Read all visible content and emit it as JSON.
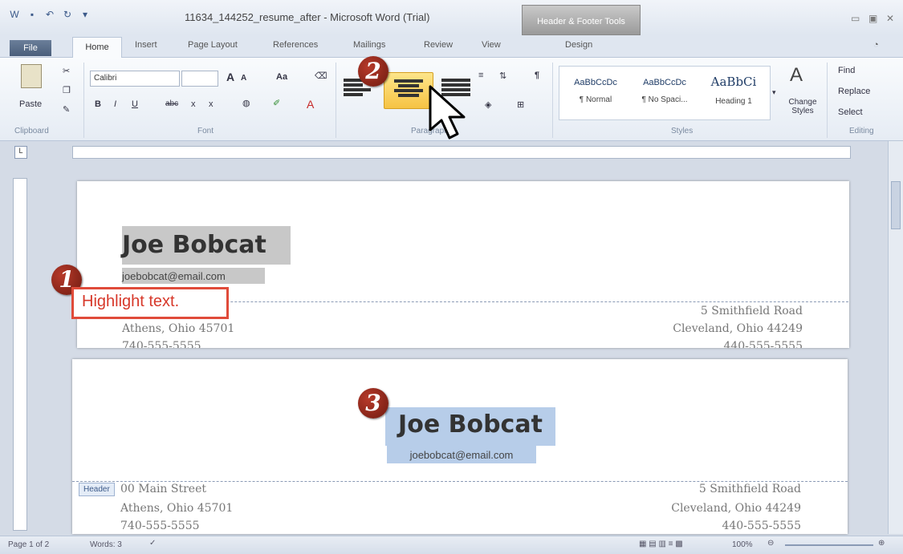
{
  "window": {
    "title": "11634_144252_resume_after - Microsoft Word (Trial)",
    "context_tools": "Header & Footer Tools",
    "context_tab": "Design"
  },
  "tabs": [
    {
      "label": "File"
    },
    {
      "label": "Home"
    },
    {
      "label": "Insert"
    },
    {
      "label": "Page Layout"
    },
    {
      "label": "References"
    },
    {
      "label": "Mailings"
    },
    {
      "label": "Review"
    },
    {
      "label": "View"
    }
  ],
  "ribbon": {
    "clipboard": {
      "label": "Clipboard",
      "paste": "Paste"
    },
    "font": {
      "label": "Font",
      "name": "Calibri",
      "size": "",
      "grow": "A",
      "shrink": "A",
      "case": "Aa",
      "bold": "B",
      "italic": "I",
      "underline": "U",
      "strike": "abc",
      "sub": "x",
      "sup": "x",
      "color": "A"
    },
    "paragraph": {
      "label": "Paragraph"
    },
    "styles": {
      "label": "Styles",
      "items": [
        {
          "sample": "AaBbCcDc",
          "name": "¶ Normal"
        },
        {
          "sample": "AaBbCcDc",
          "name": "¶ No Spaci..."
        },
        {
          "sample": "AaBbCi",
          "name": "Heading 1"
        }
      ],
      "change": "Change Styles"
    },
    "editing": {
      "label": "Editing",
      "find": "Find",
      "replace": "Replace",
      "select": "Select"
    }
  },
  "page1": {
    "name": "Joe Bobcat",
    "email": "joebobcat@email.com",
    "left_line2": "Athens, Ohio 45701",
    "left_line3": "740-555-5555",
    "right_line1": "5 Smithfield Road",
    "right_line2": "Cleveland, Ohio 44249",
    "right_line3": "440-555-5555"
  },
  "page2": {
    "name": "Joe Bobcat",
    "email": "joebobcat@email.com",
    "header_tag": "Header",
    "left_line1": "00 Main Street",
    "left_line2": "Athens, Ohio 45701",
    "left_line3": "740-555-5555",
    "right_line1": "5 Smithfield Road",
    "right_line2": "Cleveland, Ohio 44249",
    "right_line3": "440-555-5555"
  },
  "callouts": {
    "step1": "1",
    "step1_text": "Highlight text.",
    "step2": "2",
    "step3": "3"
  },
  "status": {
    "page": "Page 1 of 2",
    "words": "Words: 3",
    "zoom": "100%"
  },
  "colors": {
    "accent": "#e04b3a",
    "highlight_gray": "#c8c8c8",
    "highlight_blue": "#b7cde9"
  }
}
